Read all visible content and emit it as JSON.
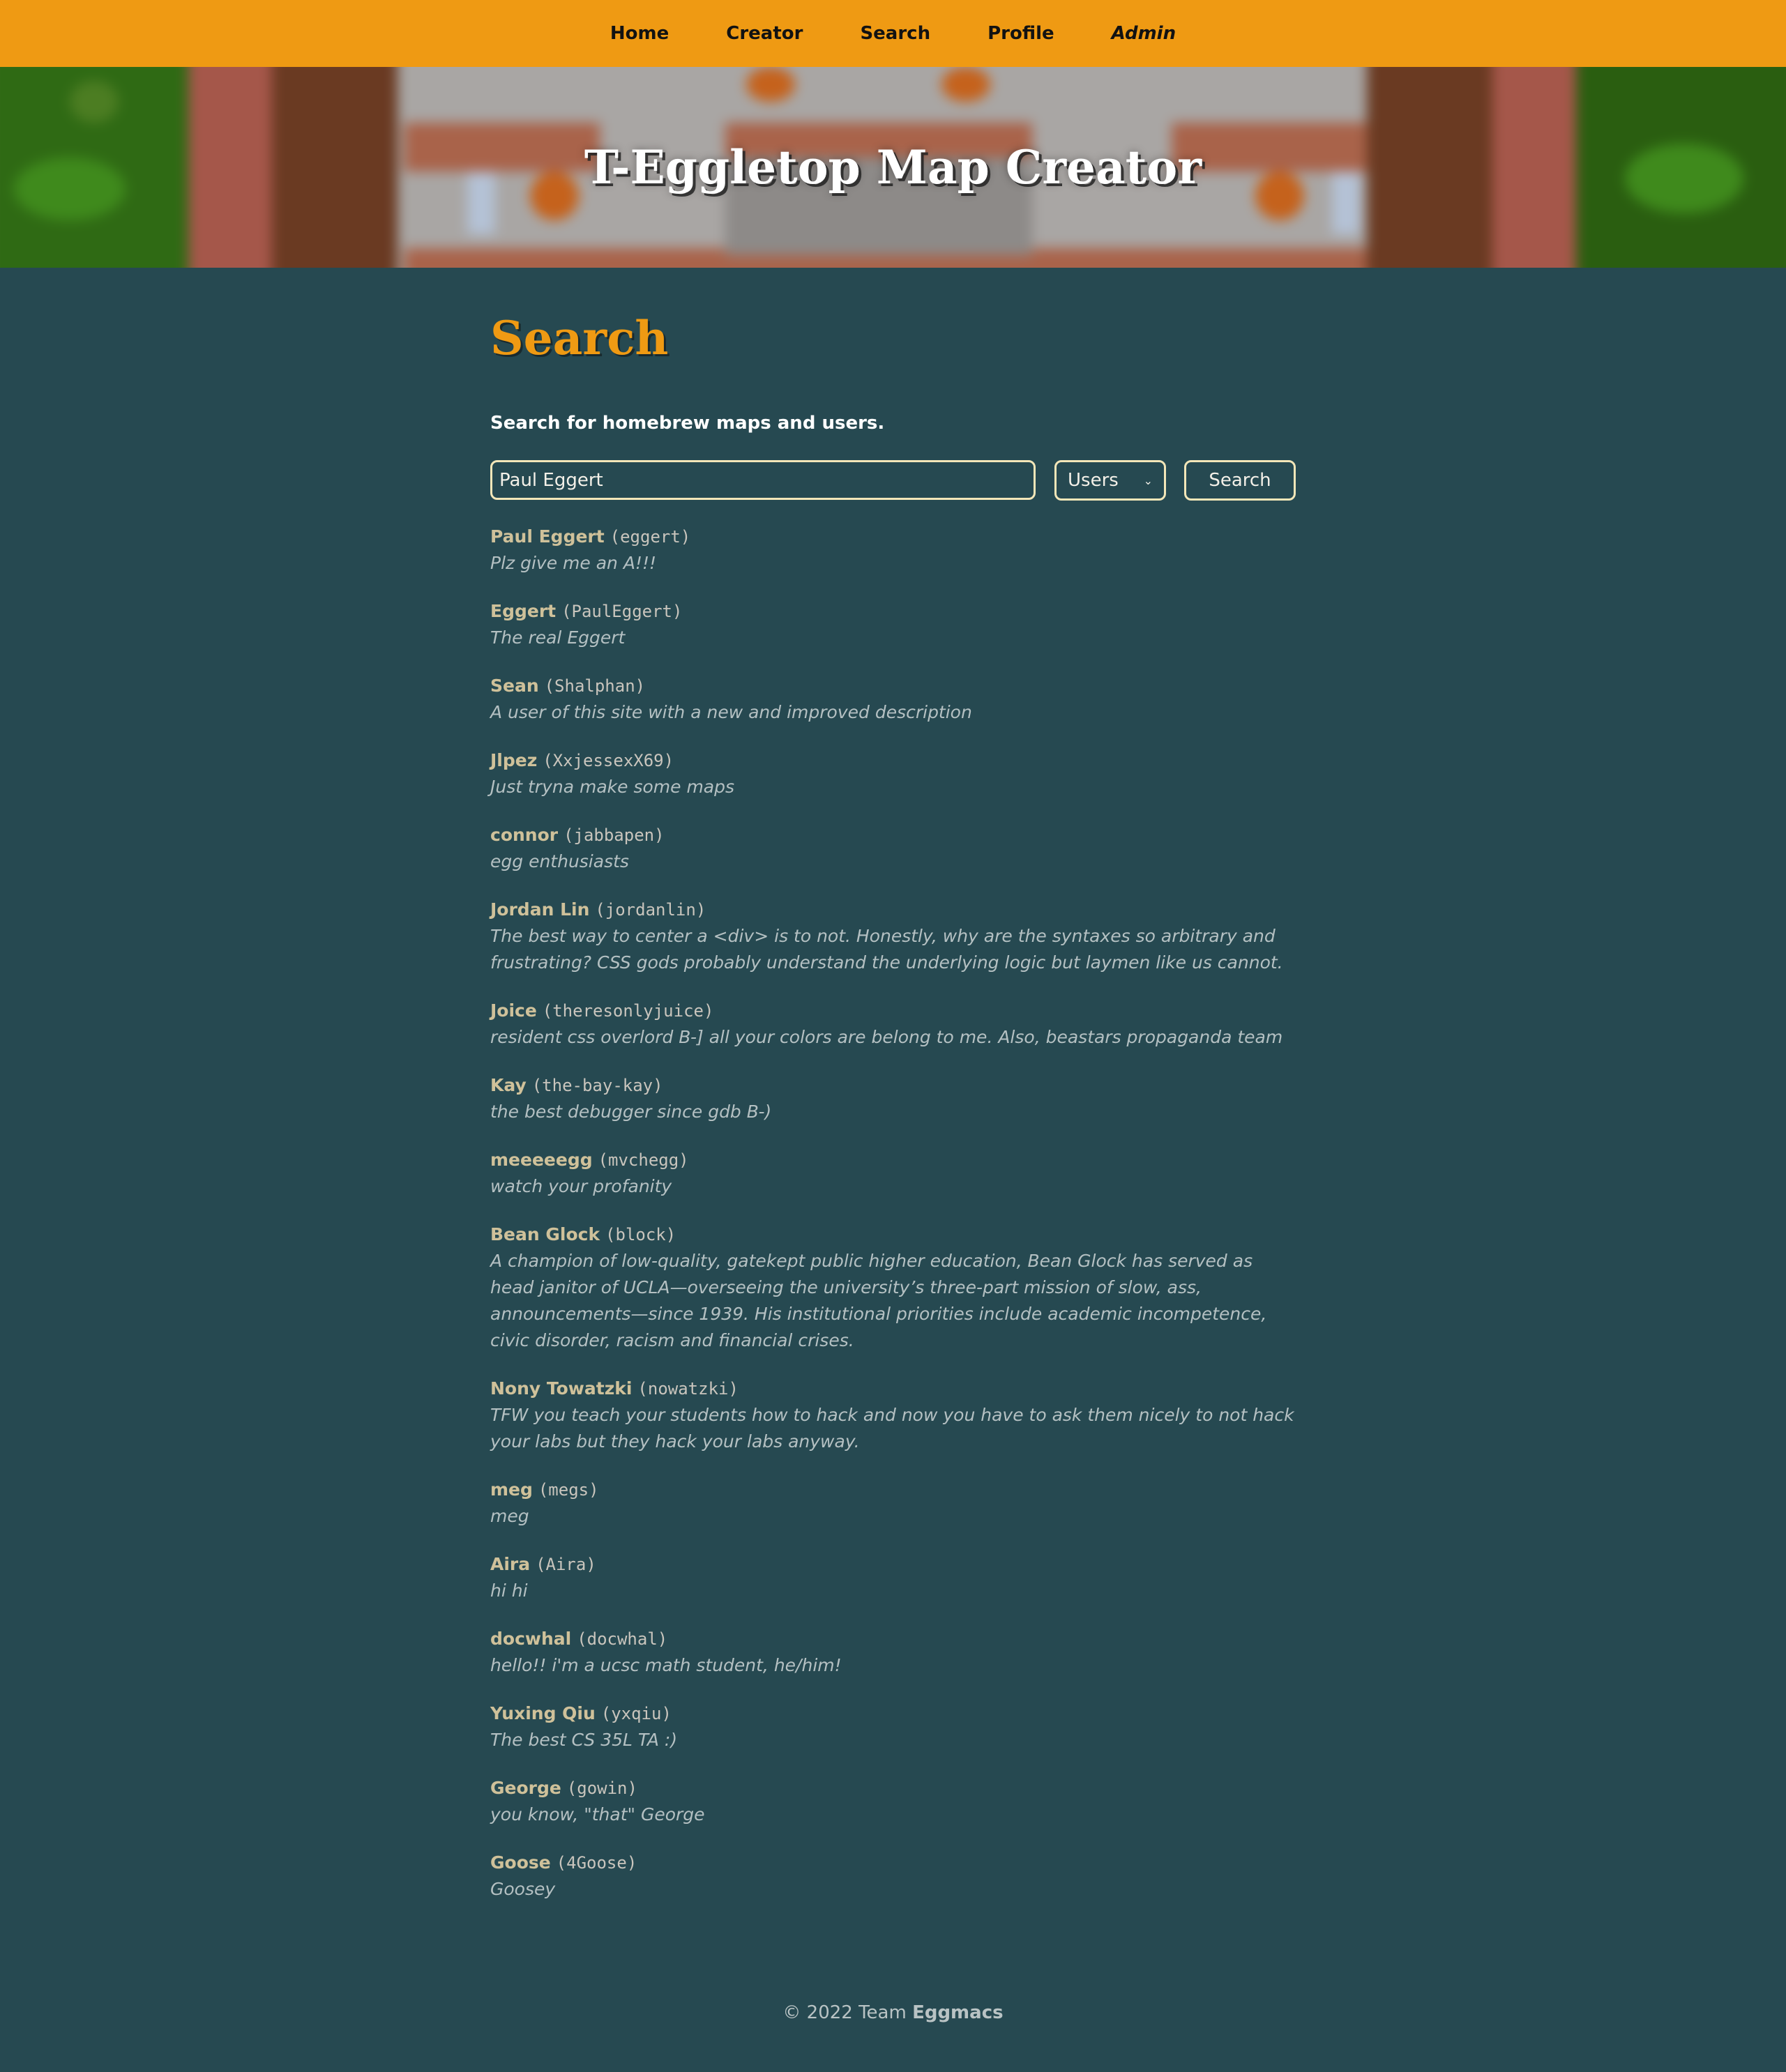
{
  "nav": {
    "items": [
      {
        "label": "Home"
      },
      {
        "label": "Creator"
      },
      {
        "label": "Search"
      },
      {
        "label": "Profile"
      },
      {
        "label": "Admin"
      }
    ]
  },
  "hero": {
    "title": "T-Eggletop Map Creator"
  },
  "page": {
    "title": "Search",
    "subtitle": "Search for homebrew maps and users."
  },
  "search": {
    "query": "Paul Eggert",
    "type_selected": "Users",
    "button_label": "Search"
  },
  "results": [
    {
      "name": "Paul Eggert",
      "username": "(eggert)",
      "bio": "Plz give me an A!!!"
    },
    {
      "name": "Eggert",
      "username": "(PaulEggert)",
      "bio": "The real Eggert"
    },
    {
      "name": "Sean",
      "username": "(Shalphan)",
      "bio": "A user of this site with a new and improved description"
    },
    {
      "name": "Jlpez",
      "username": "(XxjessexX69)",
      "bio": "Just tryna make some maps"
    },
    {
      "name": "connor",
      "username": "(jabbapen)",
      "bio": "egg enthusiasts"
    },
    {
      "name": "Jordan Lin",
      "username": "(jordanlin)",
      "bio": "The best way to center a <div> is to not. Honestly, why are the syntaxes so arbitrary and frustrating? CSS gods probably understand the underlying logic but laymen like us cannot."
    },
    {
      "name": "Joice",
      "username": "(theresonlyjuice)",
      "bio": "resident css overlord B-] all your colors are belong to me. Also, beastars propaganda team"
    },
    {
      "name": "Kay",
      "username": "(the-bay-kay)",
      "bio": "the best debugger since gdb B-)"
    },
    {
      "name": "meeeeegg",
      "username": "(mvchegg)",
      "bio": "watch your profanity"
    },
    {
      "name": "Bean Glock",
      "username": "(block)",
      "bio": "A champion of low-quality, gatekept public higher education, Bean Glock has served as head janitor of UCLA—overseeing the university’s three-part mission of slow, ass, announcements—since 1939. His institutional priorities include academic incompetence, civic disorder, racism and financial crises."
    },
    {
      "name": "Nony Towatzki",
      "username": "(nowatzki)",
      "bio": "TFW you teach your students how to hack and now you have to ask them nicely to not hack your labs but they hack your labs anyway."
    },
    {
      "name": "meg",
      "username": "(megs)",
      "bio": "meg"
    },
    {
      "name": "Aira",
      "username": "(Aira)",
      "bio": "hi hi"
    },
    {
      "name": "docwhal",
      "username": "(docwhal)",
      "bio": "hello!! i'm a ucsc math student, he/him!"
    },
    {
      "name": "Yuxing Qiu",
      "username": "(yxqiu)",
      "bio": "The best CS 35L TA :)"
    },
    {
      "name": "George",
      "username": "(gowin)",
      "bio": "you know, \"that\" George"
    },
    {
      "name": "Goose",
      "username": "(4Goose)",
      "bio": "Goosey"
    }
  ],
  "footer": {
    "copyright": "© 2022 Team",
    "team": "Eggmacs"
  },
  "colors": {
    "nav_bg": "#ef9a13",
    "page_bg": "#264951",
    "accent": "#ef9a13",
    "name_text": "#cfc19a",
    "input_border": "#f3e6b8"
  }
}
